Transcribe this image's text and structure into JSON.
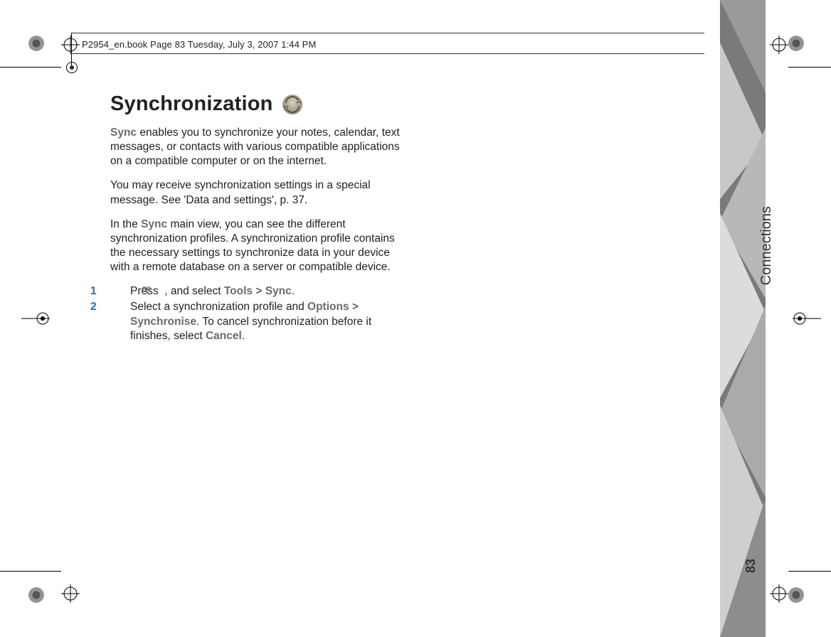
{
  "header": {
    "line": "P2954_en.book  Page 83  Tuesday, July 3, 2007  1:44 PM"
  },
  "title": "Synchronization",
  "paragraphs": {
    "p1_lead": "Sync",
    "p1_rest": " enables you to synchronize your notes, calendar, text messages, or contacts with various compatible applications on a compatible computer or on the internet.",
    "p2": "You may receive synchronization settings in a special message. See 'Data and settings', p. 37.",
    "p3_a": "In the ",
    "p3_bold": "Sync",
    "p3_b": " main view, you can see the different synchronization profiles. A synchronization profile contains the necessary settings to synchronize data in your device with a remote database on a server or compatible device."
  },
  "steps": {
    "s1_num": "1",
    "s1_a": "Press  ",
    "s1_b": " , and select ",
    "s1_tools": "Tools",
    "s1_gt": " > ",
    "s1_sync": "Sync",
    "s1_end": ".",
    "s2_num": "2",
    "s2_a": "Select a synchronization profile and ",
    "s2_options": "Options",
    "s2_gt": " > ",
    "s2_syncr": "Synchronise",
    "s2_b": ". To cancel synchronization before it finishes, select ",
    "s2_cancel": "Cancel",
    "s2_end": "."
  },
  "sidebar": {
    "label": "Connections",
    "page_number": "83"
  }
}
